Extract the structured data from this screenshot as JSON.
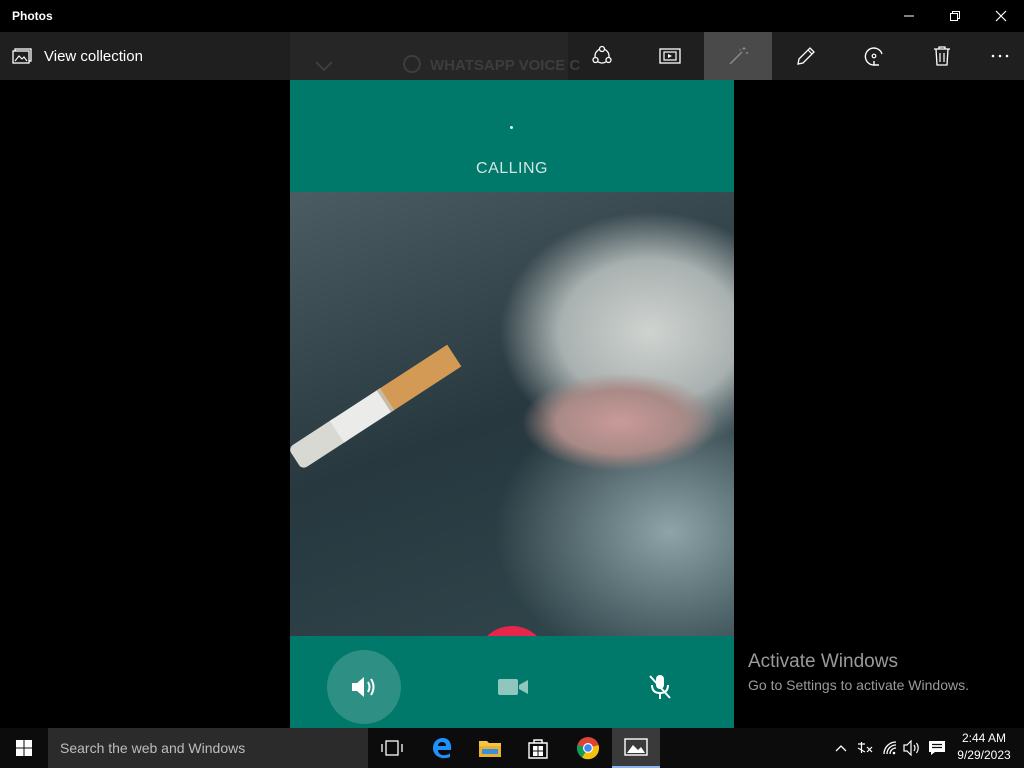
{
  "window": {
    "title": "Photos"
  },
  "toolbar": {
    "view_collection_label": "View collection"
  },
  "call": {
    "status": "CALLING",
    "header_faded_text": "WHATSAPP VOICE C"
  },
  "watermark": {
    "heading": "Activate Windows",
    "subtext": "Go to Settings to activate Windows."
  },
  "taskbar": {
    "search_placeholder": "Search the web and Windows",
    "clock_time": "2:44 AM",
    "clock_date": "9/29/2023"
  },
  "colors": {
    "whatsapp_teal": "#00786a",
    "end_call_red": "#e8254a",
    "accent": "#8ab4f8"
  },
  "icons": [
    "photos-collection-icon",
    "share-icon",
    "slideshow-icon",
    "enhance-icon",
    "edit-icon",
    "rotate-icon",
    "delete-icon",
    "more-icon",
    "end-call-icon",
    "speaker-icon",
    "video-icon",
    "mic-off-icon",
    "windows-start-icon",
    "task-view-icon",
    "edge-icon",
    "file-explorer-icon",
    "store-icon",
    "chrome-icon",
    "photos-app-icon",
    "chevron-up-icon",
    "ime-icon",
    "wifi-icon",
    "volume-icon",
    "action-center-icon"
  ]
}
